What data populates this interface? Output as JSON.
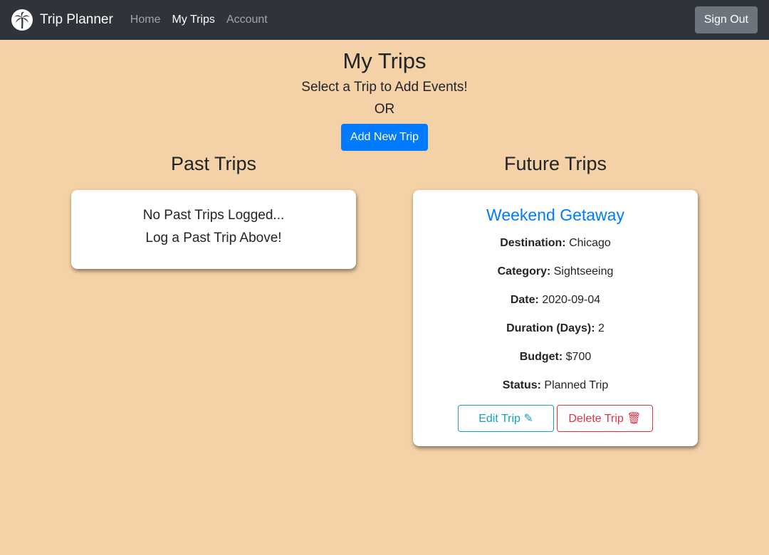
{
  "nav": {
    "brand": "Trip Planner",
    "brand_icon": "palm-tree-icon",
    "links": [
      "Home",
      "My Trips",
      "Account"
    ],
    "active": "My Trips",
    "signout_label": "Sign Out"
  },
  "header": {
    "title": "My Trips",
    "subtitle": "Select a Trip to Add Events!",
    "or": "OR",
    "add_label": "Add New Trip"
  },
  "past": {
    "title": "Past Trips",
    "empty_line1": "No Past Trips Logged...",
    "empty_line2": "Log a Past Trip Above!"
  },
  "future": {
    "title": "Future Trips",
    "trips": [
      {
        "name": "Weekend Getaway",
        "fields": [
          {
            "label": "Destination:",
            "value": "Chicago"
          },
          {
            "label": "Category:",
            "value": "Sightseeing"
          },
          {
            "label": "Date:",
            "value": "2020-09-04"
          },
          {
            "label": "Duration (Days):",
            "value": "2"
          },
          {
            "label": "Budget:",
            "value": "$700"
          },
          {
            "label": "Status:",
            "value": "Planned Trip"
          }
        ],
        "edit_label": "Edit Trip",
        "edit_icon": "✎",
        "delete_label": "Delete Trip",
        "delete_icon": "🗑"
      }
    ]
  },
  "colors": {
    "background": "#f4d1a6",
    "navbar": "#2f343a",
    "primary": "#007bff",
    "info": "#17a2b8",
    "danger": "#dc3545",
    "secondary": "#6c757d"
  }
}
